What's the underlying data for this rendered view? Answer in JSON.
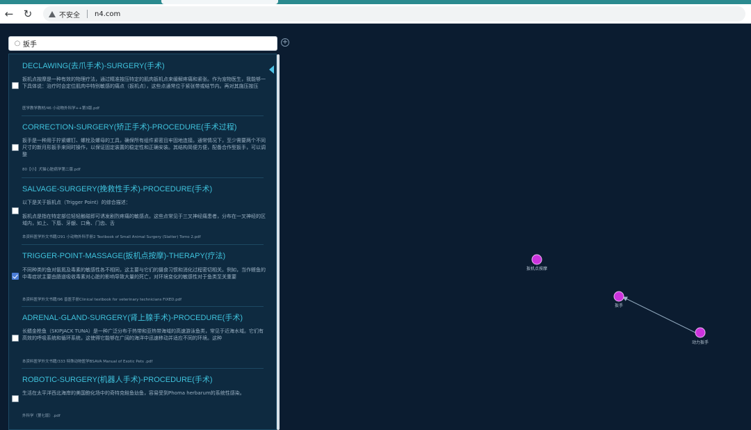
{
  "browser": {
    "security_text": "不安全",
    "url": "n4.com"
  },
  "search": {
    "query": "扳手"
  },
  "results": [
    {
      "title": "DECLAWING(去爪手术)-SURGERY(手术)",
      "body": "扳机点按摩是一种有效的物理疗法，通过精准按压特定的肌肉扳机点来缓解疼痛和紧张。作为宠物医生，我能够一下具体说：治疗时会定位肌肉中特别敏感的痛点（扳机点），这些点通常位于紧张带或结节内。再对其施压按压",
      "source": "医学教学教材/46 小动物外科学++第3版.pdf",
      "checked": false
    },
    {
      "title": "CORRECTION-SURGERY(矫正手术)-PROCEDURE(手术过程)",
      "body": "扳手是一种用于拧紧螺钉、螺栓及螺母的工具，确保所有组件紧密且牢固地连接。通常情况下，至少需要两个不同尺寸的新月形扳手来同时操作，以保证固定装置的稳定性和正确安装。其结构简便方便，配备合作型扳手，可以调整",
      "source": "80【小】犬猫心脏病学第二版.pdf",
      "checked": false
    },
    {
      "title": "SALVAGE-SURGERY(挽救性手术)-PROCEDURE(手术)",
      "body": "以下是关于扳机点（Trigger Point）的综合描述：\n\n扳机点是指在特定部位轻轻触碰即可诱发剧烈疼痛的敏感点。这些点常见于三叉神经痛患者，分布在一叉神经的区域内，如上、下唇、牙龈、口角、门齿、舌",
      "source": "本资料医学外文书籍/291 小动物外科手册2 Textbook of Small Animal Surgery (Slatter) Tomo 2.pdf",
      "checked": false
    },
    {
      "title": "TRIGGER-POINT-MASSAGE(扳机点按摩)-THERAPY(疗法)",
      "body": "不同种类的鱼对氨氮及毒素的敏感性各不相同，这主要与它们的摄食习惯和消化过程密切相关。例如，当作鲣鱼的中毒症状主要由肠道吸收毒素对心脏的影响导致大量的死亡，对环境变化的敏感性对于鱼类至关重要",
      "source": "本资料医学外文书籍/96 兽医手册Clinical textbook for veterinary technicians FIXED.pdf",
      "checked": true
    },
    {
      "title": "ADRENAL-GLAND-SURGERY(肾上腺手术)-PROCEDURE(手术)",
      "body": "长鳍金枪鱼（SKIPJACK TUNA）是一种广泛分布于热带和亚热带海域的高速游泳鱼类，常见于近海水域。它们有高效的呼吸系统和循环系统，这使得它能够在广阔的海洋中迅速移动并适应不同的环境。这种",
      "source": "本资料医学外文书籍/333 特殊动物医学BSAVA Manual of Exotic Pets .pdf",
      "checked": false
    },
    {
      "title": "ROBOTIC-SURGERY(机器人手术)-PROCEDURE(手术)",
      "body": "生活在太平洋西北海岸的美国鲍化场中的奇特克鲑鱼幼鱼，容易受到Phoma herbarum的系统性感染。",
      "source": "外科学（第七版）.pdf",
      "checked": false
    }
  ],
  "graph": {
    "nodes": [
      {
        "id": "n1",
        "label": "扳机点按摩"
      },
      {
        "id": "n2",
        "label": "扳手"
      },
      {
        "id": "n3",
        "label": "动力扳手"
      }
    ],
    "edges": [
      {
        "from": "n3",
        "to": "n2"
      }
    ],
    "node_color": "#cc33dd"
  }
}
